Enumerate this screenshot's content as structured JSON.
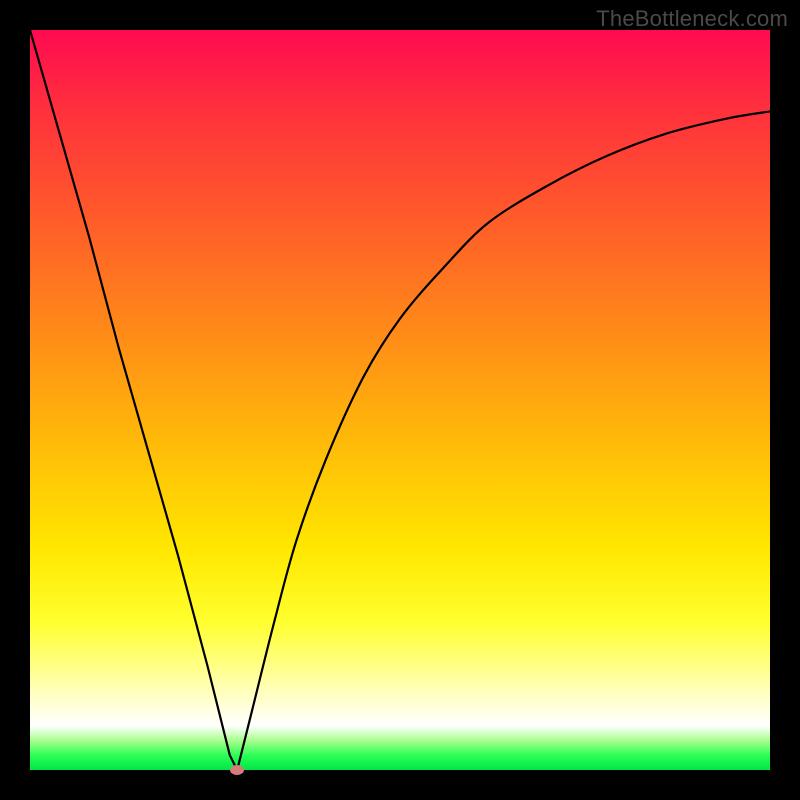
{
  "watermark": "TheBottleneck.com",
  "chart_data": {
    "type": "line",
    "title": "",
    "xlabel": "",
    "ylabel": "",
    "xlim": [
      0,
      100
    ],
    "ylim": [
      0,
      100
    ],
    "grid": false,
    "legend": false,
    "series": [
      {
        "name": "bottleneck-curve-left",
        "x": [
          0,
          4,
          8,
          12,
          16,
          20,
          24,
          27,
          28
        ],
        "values": [
          100,
          86,
          72,
          57,
          43,
          29,
          14,
          2,
          0
        ]
      },
      {
        "name": "bottleneck-curve-right",
        "x": [
          28,
          30,
          33,
          36,
          40,
          45,
          50,
          56,
          62,
          70,
          78,
          86,
          94,
          100
        ],
        "values": [
          0,
          8,
          20,
          31,
          42,
          53,
          61,
          68,
          74,
          79,
          83,
          86,
          88,
          89
        ]
      }
    ],
    "marker": {
      "x": 28,
      "y": 0,
      "color": "#d47c7c"
    },
    "gradient_stops": [
      {
        "pos": 0,
        "color": "#ff0a52"
      },
      {
        "pos": 10,
        "color": "#ff2e3e"
      },
      {
        "pos": 25,
        "color": "#ff5a2a"
      },
      {
        "pos": 40,
        "color": "#ff8819"
      },
      {
        "pos": 55,
        "color": "#ffb809"
      },
      {
        "pos": 70,
        "color": "#ffe700"
      },
      {
        "pos": 80,
        "color": "#ffff2e"
      },
      {
        "pos": 86,
        "color": "#ffff88"
      },
      {
        "pos": 91,
        "color": "#ffffd4"
      },
      {
        "pos": 94,
        "color": "#ffffff"
      },
      {
        "pos": 96,
        "color": "#a9ff90"
      },
      {
        "pos": 98,
        "color": "#2dff56"
      },
      {
        "pos": 100,
        "color": "#00e648"
      }
    ]
  }
}
